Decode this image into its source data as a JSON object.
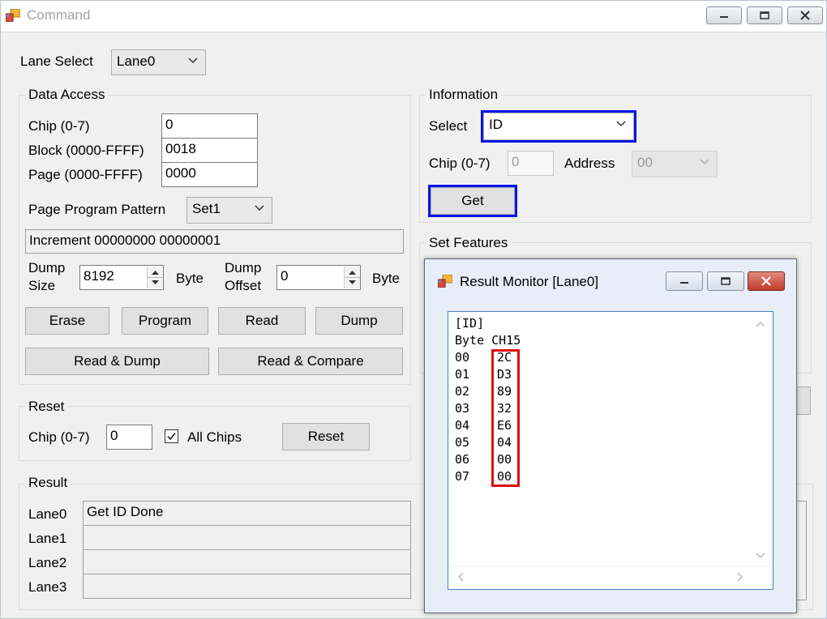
{
  "window": {
    "title": "Command"
  },
  "lane_select": {
    "label": "Lane Select",
    "value": "Lane0"
  },
  "data_access": {
    "group_label": "Data Access",
    "chip_label": "Chip (0-7)",
    "chip_value": "0",
    "block_label": "Block (0000-FFFF)",
    "block_value": "0018",
    "page_label": "Page (0000-FFFF)",
    "page_value": "0000",
    "pattern_label": "Page Program Pattern",
    "pattern_value": "Set1",
    "pattern_text": "Increment 00000000 00000001",
    "dump_size_label_1": "Dump",
    "dump_size_label_2": "Size",
    "dump_size_value": "8192",
    "dump_size_unit": "Byte",
    "dump_offset_label_1": "Dump",
    "dump_offset_label_2": "Offset",
    "dump_offset_value": "0",
    "dump_offset_unit": "Byte",
    "erase_label": "Erase",
    "program_label": "Program",
    "read_label": "Read",
    "dump_label": "Dump",
    "read_dump_label": "Read & Dump",
    "read_compare_label": "Read & Compare"
  },
  "reset": {
    "group_label": "Reset",
    "chip_label": "Chip (0-7)",
    "chip_value": "0",
    "all_chips_label": "All Chips",
    "all_chips_checked": true,
    "reset_label": "Reset"
  },
  "result": {
    "group_label": "Result",
    "lanes": [
      {
        "label": "Lane0",
        "value": "Get ID Done"
      },
      {
        "label": "Lane1",
        "value": ""
      },
      {
        "label": "Lane2",
        "value": ""
      },
      {
        "label": "Lane3",
        "value": ""
      }
    ]
  },
  "information": {
    "group_label": "Information",
    "select_label": "Select",
    "select_value": "ID",
    "chip_label": "Chip (0-7)",
    "chip_value": "0",
    "address_label": "Address",
    "address_value": "00",
    "get_label": "Get"
  },
  "set_features": {
    "group_label": "Set Features"
  },
  "monitor": {
    "title": "Result Monitor [Lane0]",
    "header_line": "[ID]",
    "col_header": "Byte CH15",
    "rows": [
      {
        "byte": "00",
        "value": "2C"
      },
      {
        "byte": "01",
        "value": "D3"
      },
      {
        "byte": "02",
        "value": "89"
      },
      {
        "byte": "03",
        "value": "32"
      },
      {
        "byte": "04",
        "value": "E6"
      },
      {
        "byte": "05",
        "value": "04"
      },
      {
        "byte": "06",
        "value": "00"
      },
      {
        "byte": "07",
        "value": "00"
      }
    ]
  },
  "colors": {
    "highlight_blue": "#0a14e6",
    "highlight_red": "#e01010",
    "close_red": "#c9483c"
  }
}
